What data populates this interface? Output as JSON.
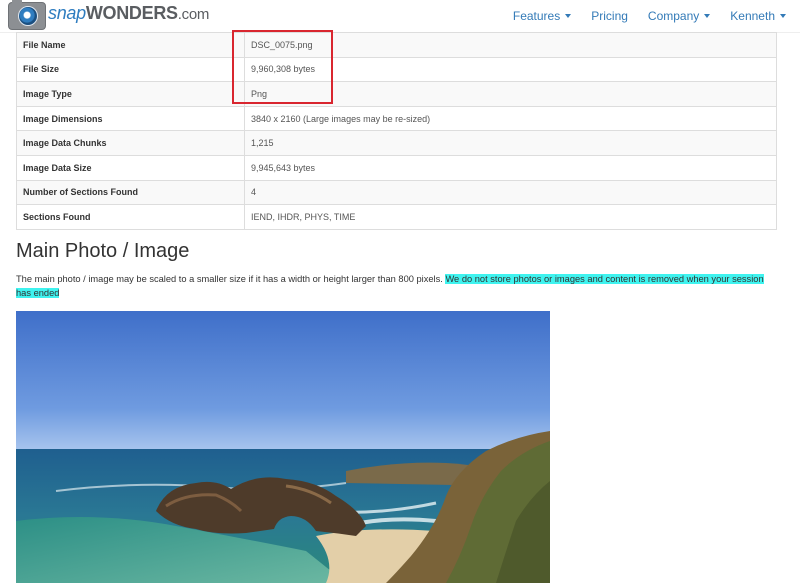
{
  "brand": {
    "name_snap": "snap",
    "name_wonders": "WONDERS",
    "name_domain": ".com",
    "colors": {
      "blue": "#2f7dc0",
      "gray": "#5a5d61"
    }
  },
  "nav": {
    "features": "Features",
    "pricing": "Pricing",
    "company": "Company",
    "user": "Kenneth"
  },
  "file_info": [
    {
      "key": "File Name",
      "value": "DSC_0075.png"
    },
    {
      "key": "File Size",
      "value": "9,960,308 bytes"
    },
    {
      "key": "Image Type",
      "value": "Png"
    },
    {
      "key": "Image Dimensions",
      "value": "3840 x 2160 (Large images may be re-sized)"
    },
    {
      "key": "Image Data Chunks",
      "value": "1,215"
    },
    {
      "key": "Image Data Size",
      "value": "9,945,643 bytes"
    },
    {
      "key": "Number of Sections Found",
      "value": "4"
    },
    {
      "key": "Sections Found",
      "value": "IEND, IHDR, PHYS, TIME"
    }
  ],
  "main": {
    "title": "Main Photo / Image",
    "desc_plain": "The main photo / image may be scaled to a smaller size if it has a width or height larger than 800 pixels.",
    "desc_highlight": "We do not store photos or images and content is removed when your session has ended",
    "highlight_color": "#3ff3ef"
  },
  "accent": {
    "link": "#337ab7",
    "annotation_box": "#d9262f"
  }
}
